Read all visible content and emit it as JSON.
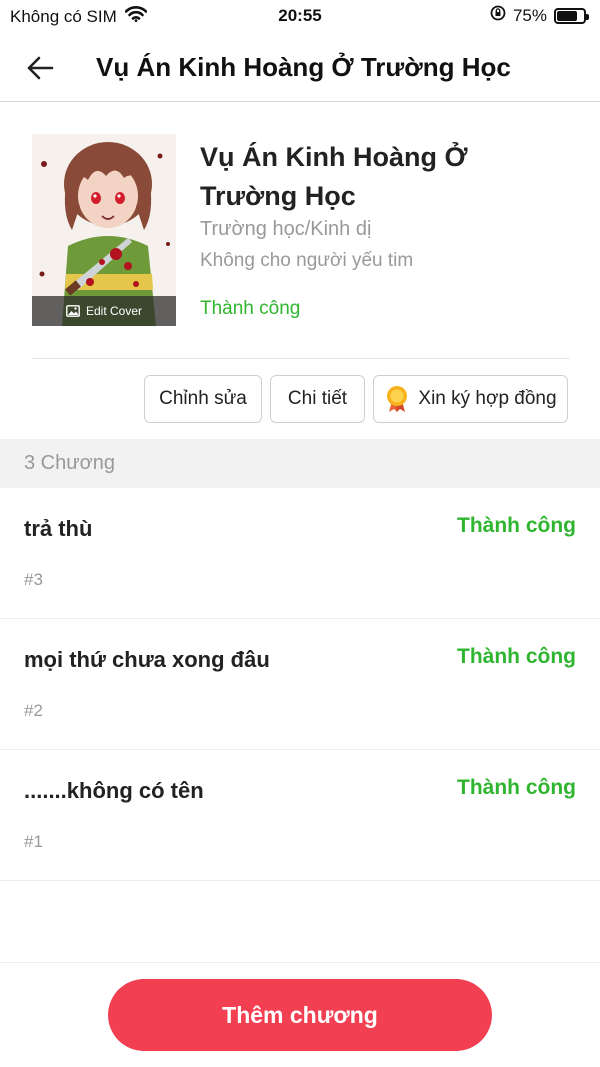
{
  "status_bar": {
    "carrier": "Không có SIM",
    "time": "20:55",
    "battery_percent": "75%",
    "battery_level": 0.75
  },
  "nav": {
    "title": "Vụ Án Kinh Hoàng Ở Trường Học",
    "back_icon": "arrow-left-icon"
  },
  "book": {
    "title": "Vụ Án Kinh Hoàng Ở Trường Học",
    "genre": "Trường học/Kinh dị",
    "warning": "Không cho người yếu tim",
    "status": "Thành công",
    "edit_cover_label": "Edit Cover"
  },
  "actions": {
    "edit_label": "Chỉnh sửa",
    "details_label": "Chi tiết",
    "contract_label": "Xin ký hợp đồng"
  },
  "chapters": {
    "count_label": "3 Chương",
    "items": [
      {
        "title": "trả thù",
        "number": "#3",
        "status": "Thành công"
      },
      {
        "title": "mọi thứ chưa xong đâu",
        "number": "#2",
        "status": "Thành công"
      },
      {
        "title": ".......không có tên",
        "number": "#1",
        "status": "Thành công"
      }
    ]
  },
  "footer": {
    "add_chapter_label": "Thêm chương"
  },
  "colors": {
    "accent": "#f23f52",
    "success": "#2fb52f",
    "muted": "#999999"
  }
}
